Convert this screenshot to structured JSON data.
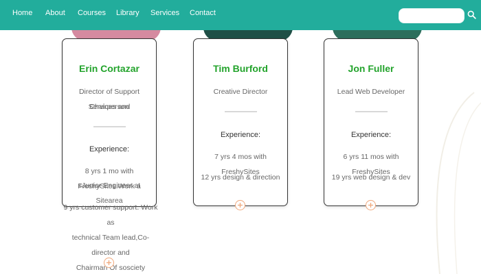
{
  "nav": {
    "items": [
      "Home",
      "About",
      "Courses",
      "Library",
      "Services",
      "Contact"
    ],
    "search_value": "",
    "bar_color": "#22ad9c"
  },
  "cards": [
    {
      "name": "Erin Cortazar",
      "title": [
        "Director of Support Services and",
        "Chairperson"
      ],
      "experience_label": "Experience:",
      "lines": [
        "8 yrs 1 mo with FreshySites.Work a",
        "sJunior Engineer at Sitearea",
        "9 yrs customer support. Work as",
        "technical Team lead,Co-director and",
        "Chairman Of sosciety"
      ]
    },
    {
      "name": "Tim Burford",
      "title": [
        "Creative Director"
      ],
      "experience_label": "Experience:",
      "lines": [
        "7 yrs 4 mos with FreshySites",
        "12 yrs design & direction"
      ]
    },
    {
      "name": "Jon Fuller",
      "title": [
        "Lead Web Developer"
      ],
      "experience_label": "Experience:",
      "lines": [
        "6 yrs 11 mos with FreshySites",
        "19 yrs web design & dev"
      ]
    }
  ],
  "colors": {
    "name": "#22a32b",
    "plus_outline": "#f0a77a",
    "photo_1": "#d58aa0",
    "photo_2": "#1f4f46",
    "photo_3": "#2d6e5c"
  },
  "icons": [
    "search-icon",
    "plus-circle-icon"
  ]
}
